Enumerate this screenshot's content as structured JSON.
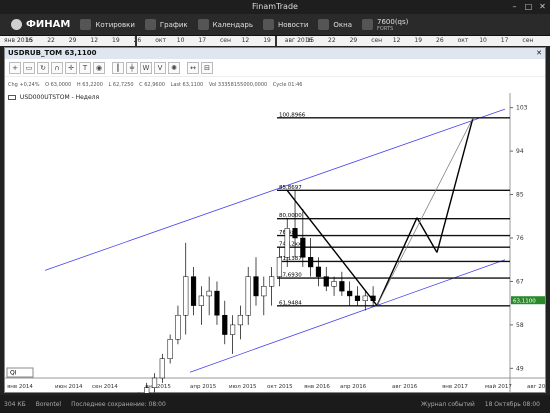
{
  "window": {
    "title": "FinamTrade",
    "minimize": "–",
    "maximize": "□",
    "close": "✕"
  },
  "toolbar": {
    "logo": "ФИНАМ",
    "quotes": "Котировки",
    "chart": "График",
    "calendar": "Календарь",
    "news": "Новости",
    "windows": "Окна",
    "account_value": "7600(qs)",
    "account_sub": "FORTS"
  },
  "timestrip": {
    "labels": [
      "янв 2016",
      "15",
      "22",
      "29",
      "12",
      "19",
      "26",
      "окт",
      "10",
      "17",
      "сен",
      "12",
      "19",
      "авг 2016",
      "15",
      "22",
      "29",
      "сен",
      "12",
      "19",
      "26",
      "окт",
      "10",
      "17",
      "сен"
    ]
  },
  "chart_window": {
    "title": "USDRUB_TOM 63,1100",
    "close": "✕",
    "info": {
      "chg": "Chg +0,24%",
      "open": "O 63,0000",
      "high": "H 63,2200",
      "low": "L 62,7250",
      "close": "C 62,9600",
      "last": "Last 63,1100",
      "vol": "Vol 33358155000,0000",
      "cycle": "Cycle 01:46"
    },
    "legend": "USD000UTSTOM - Неделя",
    "ticker_input": "QI"
  },
  "chart_data": {
    "type": "candlestick",
    "series": [
      {
        "name": "USD000UTSTOM",
        "label": "Неделя"
      }
    ],
    "last_price": "63,1100",
    "y_ticks": [
      "103",
      "94",
      "85",
      "76",
      "67",
      "58",
      "49"
    ],
    "x_ticks": [
      "янв 2014",
      "июн 2014",
      "сен 2014",
      "янв 2015",
      "апр 2015",
      "июл 2015",
      "окт 2015",
      "янв 2016",
      "апр 2016",
      "авг 2016",
      "янв 2017",
      "май 2017",
      "авг 2017"
    ],
    "levels": [
      {
        "price": 100.8966,
        "label": "100,8966"
      },
      {
        "price": 85.8697,
        "label": "85,8697"
      },
      {
        "price": 80.0,
        "label": "80,0000"
      },
      {
        "price": 76.5,
        "label": "76,4xx"
      },
      {
        "price": 74.1,
        "label": "74,12xx"
      },
      {
        "price": 71.1387,
        "label": "71,1387"
      },
      {
        "price": 67.693,
        "label": "67,6930"
      },
      {
        "price": 61.9484,
        "label": "61,9484"
      }
    ],
    "candles": [
      [
        42,
        44,
        41,
        43
      ],
      [
        43,
        46,
        42,
        45
      ],
      [
        45,
        48,
        44,
        47
      ],
      [
        47,
        52,
        46,
        51
      ],
      [
        51,
        56,
        50,
        55
      ],
      [
        55,
        62,
        54,
        60
      ],
      [
        60,
        75,
        56,
        68
      ],
      [
        68,
        70,
        60,
        62
      ],
      [
        62,
        66,
        58,
        64
      ],
      [
        64,
        68,
        60,
        65
      ],
      [
        65,
        67,
        58,
        60
      ],
      [
        60,
        63,
        54,
        56
      ],
      [
        56,
        60,
        52,
        58
      ],
      [
        58,
        62,
        55,
        60
      ],
      [
        60,
        70,
        58,
        68
      ],
      [
        68,
        72,
        62,
        64
      ],
      [
        64,
        68,
        60,
        66
      ],
      [
        66,
        70,
        62,
        68
      ],
      [
        68,
        74,
        66,
        72
      ],
      [
        72,
        80,
        70,
        78
      ],
      [
        78,
        86,
        72,
        76
      ],
      [
        76,
        82,
        70,
        72
      ],
      [
        72,
        76,
        68,
        70
      ],
      [
        70,
        72,
        66,
        68
      ],
      [
        68,
        70,
        65,
        66
      ],
      [
        66,
        68,
        64,
        67
      ],
      [
        67,
        69,
        64,
        65
      ],
      [
        65,
        67,
        62,
        64
      ],
      [
        64,
        66,
        62,
        63
      ],
      [
        63,
        65,
        61,
        64
      ],
      [
        64,
        66,
        62,
        63
      ]
    ]
  },
  "status": {
    "speed": "304 КБ",
    "server": "Borentel",
    "saved": "Последнее сохранение: 08:00",
    "journal": "Журнал событий",
    "datetime": "18 Октябрь 08:00"
  },
  "colors": {
    "channel": "#4444ee",
    "level": "#111111",
    "forecast": "#000000",
    "badge_bg": "#2a8a2a"
  }
}
